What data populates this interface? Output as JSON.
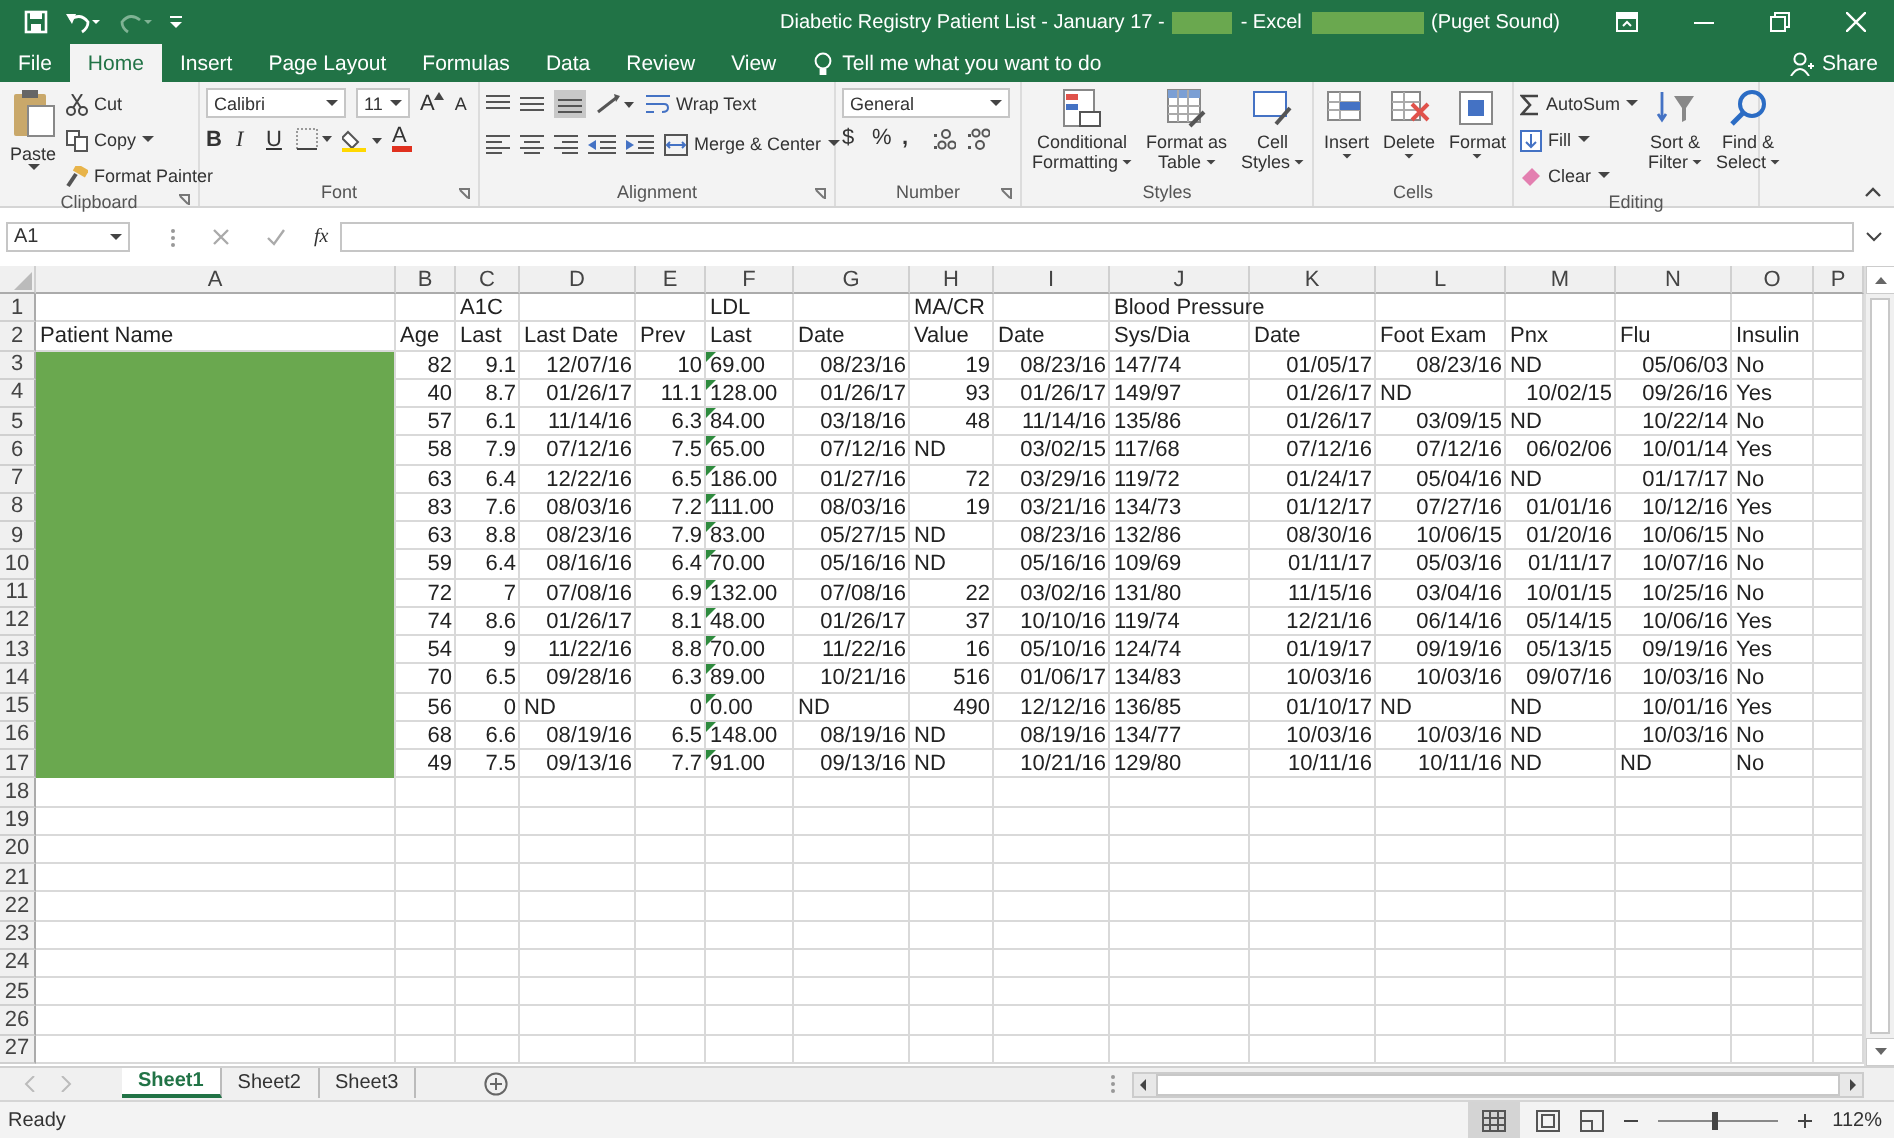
{
  "title_bar": {
    "title": "Diabetic Registry Patient List - January 17 -",
    "title_redacted": true,
    "app": "- Excel",
    "account_redacted": true,
    "account": "(Puget Sound)"
  },
  "menu_tabs": [
    {
      "label": "File",
      "selected": false
    },
    {
      "label": "Home",
      "selected": true
    },
    {
      "label": "Insert",
      "selected": false
    },
    {
      "label": "Page Layout",
      "selected": false
    },
    {
      "label": "Formulas",
      "selected": false
    },
    {
      "label": "Data",
      "selected": false
    },
    {
      "label": "Review",
      "selected": false
    },
    {
      "label": "View",
      "selected": false
    }
  ],
  "tell_me": "Tell me what you want to do",
  "share": "Share",
  "ribbon": {
    "clipboard": {
      "label": "Clipboard",
      "paste": "Paste",
      "cut": "Cut",
      "copy": "Copy",
      "format_painter": "Format Painter"
    },
    "font": {
      "label": "Font",
      "font_name": "Calibri",
      "font_size": "11",
      "grow": "A",
      "shrink": "A",
      "bold": "B",
      "italic": "I",
      "underline": "U",
      "font_color": "A"
    },
    "alignment": {
      "label": "Alignment",
      "wrap_text": "Wrap Text",
      "merge_center": "Merge & Center"
    },
    "number": {
      "label": "Number",
      "format": "General",
      "currency": "$",
      "percent": "%",
      "comma": ","
    },
    "styles": {
      "label": "Styles",
      "conditional": [
        "Conditional",
        "Formatting"
      ],
      "format_table": [
        "Format as",
        "Table"
      ],
      "cell_styles": [
        "Cell",
        "Styles"
      ]
    },
    "cells": {
      "label": "Cells",
      "insert": "Insert",
      "delete": "Delete",
      "format": "Format"
    },
    "editing": {
      "label": "Editing",
      "autosum": "AutoSum",
      "fill": "Fill",
      "clear": "Clear",
      "sort": [
        "Sort &",
        "Filter"
      ],
      "find": [
        "Find &",
        "Select"
      ]
    }
  },
  "formula_bar": {
    "name_box": "A1",
    "fx": "fx"
  },
  "sheet": {
    "columns": [
      "A",
      "B",
      "C",
      "D",
      "E",
      "F",
      "G",
      "H",
      "I",
      "J",
      "K",
      "L",
      "M",
      "N",
      "O",
      "P"
    ],
    "row_numbers": [
      "1",
      "2",
      "3",
      "4",
      "5",
      "6",
      "7",
      "8",
      "9",
      "10",
      "11",
      "12",
      "13",
      "14",
      "15",
      "16",
      "17",
      "18",
      "19",
      "20",
      "21",
      "22",
      "23",
      "24",
      "25",
      "26",
      "27"
    ],
    "rows": [
      {
        "cells": [
          null,
          null,
          {
            "text": "A1C",
            "kind": "text"
          },
          null,
          null,
          {
            "text": "LDL",
            "kind": "text"
          },
          null,
          {
            "text": "MA/CR",
            "kind": "text"
          },
          null,
          {
            "text": "Blood Pressure",
            "kind": "text"
          },
          null,
          null,
          null,
          null,
          null
        ]
      },
      {
        "cells": [
          {
            "text": "Patient Name",
            "kind": "text"
          },
          {
            "text": "Age",
            "kind": "text"
          },
          {
            "text": "Last",
            "kind": "text"
          },
          {
            "text": "Last Date",
            "kind": "text"
          },
          {
            "text": "Prev",
            "kind": "text"
          },
          {
            "text": "Last",
            "kind": "text"
          },
          {
            "text": "Date",
            "kind": "text"
          },
          {
            "text": "Value",
            "kind": "text"
          },
          {
            "text": "Date",
            "kind": "text"
          },
          {
            "text": "Sys/Dia",
            "kind": "text"
          },
          {
            "text": "Date",
            "kind": "text"
          },
          {
            "text": "Foot Exam",
            "kind": "text"
          },
          {
            "text": "Pnx",
            "kind": "text"
          },
          {
            "text": "Flu",
            "kind": "text"
          },
          {
            "text": "Insulin",
            "kind": "text"
          }
        ]
      },
      {
        "cells": [
          {
            "kind": "redacted"
          },
          {
            "text": "82",
            "kind": "num"
          },
          {
            "text": "9.1",
            "kind": "num"
          },
          {
            "text": "12/07/16",
            "kind": "num"
          },
          {
            "text": "10",
            "kind": "num"
          },
          {
            "text": "69.00",
            "kind": "numtext"
          },
          {
            "text": "08/23/16",
            "kind": "num"
          },
          {
            "text": "19",
            "kind": "num"
          },
          {
            "text": "08/23/16",
            "kind": "num"
          },
          {
            "text": "147/74",
            "kind": "text"
          },
          {
            "text": "01/05/17",
            "kind": "num"
          },
          {
            "text": "08/23/16",
            "kind": "num"
          },
          {
            "text": "ND",
            "kind": "text"
          },
          {
            "text": "05/06/03",
            "kind": "num"
          },
          {
            "text": "No",
            "kind": "text"
          }
        ]
      },
      {
        "cells": [
          {
            "kind": "redacted"
          },
          {
            "text": "40",
            "kind": "num"
          },
          {
            "text": "8.7",
            "kind": "num"
          },
          {
            "text": "01/26/17",
            "kind": "num"
          },
          {
            "text": "11.1",
            "kind": "num"
          },
          {
            "text": "128.00",
            "kind": "numtext"
          },
          {
            "text": "01/26/17",
            "kind": "num"
          },
          {
            "text": "93",
            "kind": "num"
          },
          {
            "text": "01/26/17",
            "kind": "num"
          },
          {
            "text": "149/97",
            "kind": "text"
          },
          {
            "text": "01/26/17",
            "kind": "num"
          },
          {
            "text": "ND",
            "kind": "text"
          },
          {
            "text": "10/02/15",
            "kind": "num"
          },
          {
            "text": "09/26/16",
            "kind": "num"
          },
          {
            "text": "Yes",
            "kind": "text"
          }
        ]
      },
      {
        "cells": [
          {
            "kind": "redacted"
          },
          {
            "text": "57",
            "kind": "num"
          },
          {
            "text": "6.1",
            "kind": "num"
          },
          {
            "text": "11/14/16",
            "kind": "num"
          },
          {
            "text": "6.3",
            "kind": "num"
          },
          {
            "text": "84.00",
            "kind": "numtext"
          },
          {
            "text": "03/18/16",
            "kind": "num"
          },
          {
            "text": "48",
            "kind": "num"
          },
          {
            "text": "11/14/16",
            "kind": "num"
          },
          {
            "text": "135/86",
            "kind": "text"
          },
          {
            "text": "01/26/17",
            "kind": "num"
          },
          {
            "text": "03/09/15",
            "kind": "num"
          },
          {
            "text": "ND",
            "kind": "text"
          },
          {
            "text": "10/22/14",
            "kind": "num"
          },
          {
            "text": "No",
            "kind": "text"
          }
        ]
      },
      {
        "cells": [
          {
            "kind": "redacted"
          },
          {
            "text": "58",
            "kind": "num"
          },
          {
            "text": "7.9",
            "kind": "num"
          },
          {
            "text": "07/12/16",
            "kind": "num"
          },
          {
            "text": "7.5",
            "kind": "num"
          },
          {
            "text": "65.00",
            "kind": "numtext"
          },
          {
            "text": "07/12/16",
            "kind": "num"
          },
          {
            "text": "ND",
            "kind": "text"
          },
          {
            "text": "03/02/15",
            "kind": "num"
          },
          {
            "text": "117/68",
            "kind": "text"
          },
          {
            "text": "07/12/16",
            "kind": "num"
          },
          {
            "text": "07/12/16",
            "kind": "num"
          },
          {
            "text": "06/02/06",
            "kind": "num"
          },
          {
            "text": "10/01/14",
            "kind": "num"
          },
          {
            "text": "Yes",
            "kind": "text"
          }
        ]
      },
      {
        "cells": [
          {
            "kind": "redacted"
          },
          {
            "text": "63",
            "kind": "num"
          },
          {
            "text": "6.4",
            "kind": "num"
          },
          {
            "text": "12/22/16",
            "kind": "num"
          },
          {
            "text": "6.5",
            "kind": "num"
          },
          {
            "text": "186.00",
            "kind": "numtext"
          },
          {
            "text": "01/27/16",
            "kind": "num"
          },
          {
            "text": "72",
            "kind": "num"
          },
          {
            "text": "03/29/16",
            "kind": "num"
          },
          {
            "text": "119/72",
            "kind": "text"
          },
          {
            "text": "01/24/17",
            "kind": "num"
          },
          {
            "text": "05/04/16",
            "kind": "num"
          },
          {
            "text": "ND",
            "kind": "text"
          },
          {
            "text": "01/17/17",
            "kind": "num"
          },
          {
            "text": "No",
            "kind": "text"
          }
        ]
      },
      {
        "cells": [
          {
            "kind": "redacted"
          },
          {
            "text": "83",
            "kind": "num"
          },
          {
            "text": "7.6",
            "kind": "num"
          },
          {
            "text": "08/03/16",
            "kind": "num"
          },
          {
            "text": "7.2",
            "kind": "num"
          },
          {
            "text": "111.00",
            "kind": "numtext"
          },
          {
            "text": "08/03/16",
            "kind": "num"
          },
          {
            "text": "19",
            "kind": "num"
          },
          {
            "text": "03/21/16",
            "kind": "num"
          },
          {
            "text": "134/73",
            "kind": "text"
          },
          {
            "text": "01/12/17",
            "kind": "num"
          },
          {
            "text": "07/27/16",
            "kind": "num"
          },
          {
            "text": "01/01/16",
            "kind": "num"
          },
          {
            "text": "10/12/16",
            "kind": "num"
          },
          {
            "text": "Yes",
            "kind": "text"
          }
        ]
      },
      {
        "cells": [
          {
            "kind": "redacted"
          },
          {
            "text": "63",
            "kind": "num"
          },
          {
            "text": "8.8",
            "kind": "num"
          },
          {
            "text": "08/23/16",
            "kind": "num"
          },
          {
            "text": "7.9",
            "kind": "num"
          },
          {
            "text": "83.00",
            "kind": "numtext"
          },
          {
            "text": "05/27/15",
            "kind": "num"
          },
          {
            "text": "ND",
            "kind": "text"
          },
          {
            "text": "08/23/16",
            "kind": "num"
          },
          {
            "text": "132/86",
            "kind": "text"
          },
          {
            "text": "08/30/16",
            "kind": "num"
          },
          {
            "text": "10/06/15",
            "kind": "num"
          },
          {
            "text": "01/20/16",
            "kind": "num"
          },
          {
            "text": "10/06/15",
            "kind": "num"
          },
          {
            "text": "No",
            "kind": "text"
          }
        ]
      },
      {
        "cells": [
          {
            "kind": "redacted"
          },
          {
            "text": "59",
            "kind": "num"
          },
          {
            "text": "6.4",
            "kind": "num"
          },
          {
            "text": "08/16/16",
            "kind": "num"
          },
          {
            "text": "6.4",
            "kind": "num"
          },
          {
            "text": "70.00",
            "kind": "numtext"
          },
          {
            "text": "05/16/16",
            "kind": "num"
          },
          {
            "text": "ND",
            "kind": "text"
          },
          {
            "text": "05/16/16",
            "kind": "num"
          },
          {
            "text": "109/69",
            "kind": "text"
          },
          {
            "text": "01/11/17",
            "kind": "num"
          },
          {
            "text": "05/03/16",
            "kind": "num"
          },
          {
            "text": "01/11/17",
            "kind": "num"
          },
          {
            "text": "10/07/16",
            "kind": "num"
          },
          {
            "text": "No",
            "kind": "text"
          }
        ]
      },
      {
        "cells": [
          {
            "kind": "redacted"
          },
          {
            "text": "72",
            "kind": "num"
          },
          {
            "text": "7",
            "kind": "num"
          },
          {
            "text": "07/08/16",
            "kind": "num"
          },
          {
            "text": "6.9",
            "kind": "num"
          },
          {
            "text": "132.00",
            "kind": "numtext"
          },
          {
            "text": "07/08/16",
            "kind": "num"
          },
          {
            "text": "22",
            "kind": "num"
          },
          {
            "text": "03/02/16",
            "kind": "num"
          },
          {
            "text": "131/80",
            "kind": "text"
          },
          {
            "text": "11/15/16",
            "kind": "num"
          },
          {
            "text": "03/04/16",
            "kind": "num"
          },
          {
            "text": "10/01/15",
            "kind": "num"
          },
          {
            "text": "10/25/16",
            "kind": "num"
          },
          {
            "text": "No",
            "kind": "text"
          }
        ]
      },
      {
        "cells": [
          {
            "kind": "redacted"
          },
          {
            "text": "74",
            "kind": "num"
          },
          {
            "text": "8.6",
            "kind": "num"
          },
          {
            "text": "01/26/17",
            "kind": "num"
          },
          {
            "text": "8.1",
            "kind": "num"
          },
          {
            "text": "48.00",
            "kind": "numtext"
          },
          {
            "text": "01/26/17",
            "kind": "num"
          },
          {
            "text": "37",
            "kind": "num"
          },
          {
            "text": "10/10/16",
            "kind": "num"
          },
          {
            "text": "119/74",
            "kind": "text"
          },
          {
            "text": "12/21/16",
            "kind": "num"
          },
          {
            "text": "06/14/16",
            "kind": "num"
          },
          {
            "text": "05/14/15",
            "kind": "num"
          },
          {
            "text": "10/06/16",
            "kind": "num"
          },
          {
            "text": "Yes",
            "kind": "text"
          }
        ]
      },
      {
        "cells": [
          {
            "kind": "redacted"
          },
          {
            "text": "54",
            "kind": "num"
          },
          {
            "text": "9",
            "kind": "num"
          },
          {
            "text": "11/22/16",
            "kind": "num"
          },
          {
            "text": "8.8",
            "kind": "num"
          },
          {
            "text": "70.00",
            "kind": "numtext"
          },
          {
            "text": "11/22/16",
            "kind": "num"
          },
          {
            "text": "16",
            "kind": "num"
          },
          {
            "text": "05/10/16",
            "kind": "num"
          },
          {
            "text": "124/74",
            "kind": "text"
          },
          {
            "text": "01/19/17",
            "kind": "num"
          },
          {
            "text": "09/19/16",
            "kind": "num"
          },
          {
            "text": "05/13/15",
            "kind": "num"
          },
          {
            "text": "09/19/16",
            "kind": "num"
          },
          {
            "text": "Yes",
            "kind": "text"
          }
        ]
      },
      {
        "cells": [
          {
            "kind": "redacted"
          },
          {
            "text": "70",
            "kind": "num"
          },
          {
            "text": "6.5",
            "kind": "num"
          },
          {
            "text": "09/28/16",
            "kind": "num"
          },
          {
            "text": "6.3",
            "kind": "num"
          },
          {
            "text": "89.00",
            "kind": "numtext"
          },
          {
            "text": "10/21/16",
            "kind": "num"
          },
          {
            "text": "516",
            "kind": "num"
          },
          {
            "text": "01/06/17",
            "kind": "num"
          },
          {
            "text": "134/83",
            "kind": "text"
          },
          {
            "text": "10/03/16",
            "kind": "num"
          },
          {
            "text": "10/03/16",
            "kind": "num"
          },
          {
            "text": "09/07/16",
            "kind": "num"
          },
          {
            "text": "10/03/16",
            "kind": "num"
          },
          {
            "text": "No",
            "kind": "text"
          }
        ]
      },
      {
        "cells": [
          {
            "kind": "redacted"
          },
          {
            "text": "56",
            "kind": "num"
          },
          {
            "text": "0",
            "kind": "num"
          },
          {
            "text": "ND",
            "kind": "text"
          },
          {
            "text": "0",
            "kind": "num"
          },
          {
            "text": "0.00",
            "kind": "numtext"
          },
          {
            "text": "ND",
            "kind": "text"
          },
          {
            "text": "490",
            "kind": "num"
          },
          {
            "text": "12/12/16",
            "kind": "num"
          },
          {
            "text": "136/85",
            "kind": "text"
          },
          {
            "text": "01/10/17",
            "kind": "num"
          },
          {
            "text": "ND",
            "kind": "text"
          },
          {
            "text": "ND",
            "kind": "text"
          },
          {
            "text": "10/01/16",
            "kind": "num"
          },
          {
            "text": "Yes",
            "kind": "text"
          }
        ]
      },
      {
        "cells": [
          {
            "kind": "redacted"
          },
          {
            "text": "68",
            "kind": "num"
          },
          {
            "text": "6.6",
            "kind": "num"
          },
          {
            "text": "08/19/16",
            "kind": "num"
          },
          {
            "text": "6.5",
            "kind": "num"
          },
          {
            "text": "148.00",
            "kind": "numtext"
          },
          {
            "text": "08/19/16",
            "kind": "num"
          },
          {
            "text": "ND",
            "kind": "text"
          },
          {
            "text": "08/19/16",
            "kind": "num"
          },
          {
            "text": "134/77",
            "kind": "text"
          },
          {
            "text": "10/03/16",
            "kind": "num"
          },
          {
            "text": "10/03/16",
            "kind": "num"
          },
          {
            "text": "ND",
            "kind": "text"
          },
          {
            "text": "10/03/16",
            "kind": "num"
          },
          {
            "text": "No",
            "kind": "text"
          }
        ]
      },
      {
        "cells": [
          {
            "kind": "redacted"
          },
          {
            "text": "49",
            "kind": "num"
          },
          {
            "text": "7.5",
            "kind": "num"
          },
          {
            "text": "09/13/16",
            "kind": "num"
          },
          {
            "text": "7.7",
            "kind": "num"
          },
          {
            "text": "91.00",
            "kind": "numtext"
          },
          {
            "text": "09/13/16",
            "kind": "num"
          },
          {
            "text": "ND",
            "kind": "text"
          },
          {
            "text": "10/21/16",
            "kind": "num"
          },
          {
            "text": "129/80",
            "kind": "text"
          },
          {
            "text": "10/11/16",
            "kind": "num"
          },
          {
            "text": "10/11/16",
            "kind": "num"
          },
          {
            "text": "ND",
            "kind": "text"
          },
          {
            "text": "ND",
            "kind": "text"
          },
          {
            "text": "No",
            "kind": "text"
          }
        ]
      }
    ]
  },
  "sheet_tabs": [
    {
      "label": "Sheet1",
      "selected": true
    },
    {
      "label": "Sheet2",
      "selected": false
    },
    {
      "label": "Sheet3",
      "selected": false
    }
  ],
  "status_bar": {
    "status": "Ready",
    "zoom": {
      "level": 0.47
    },
    "zoom_reading": "112%"
  }
}
